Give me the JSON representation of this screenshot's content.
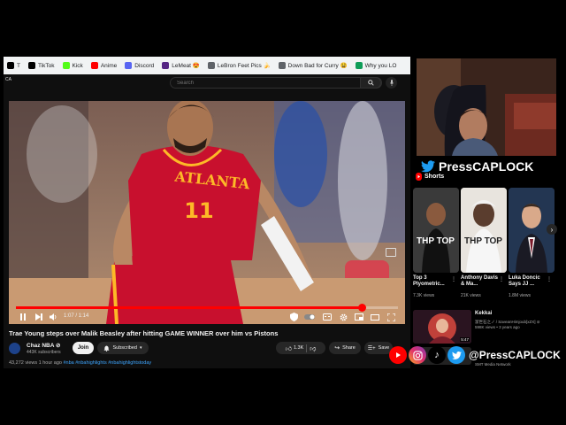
{
  "bookmarks": [
    {
      "label": "T",
      "icon": "x-icon",
      "color": "#000000"
    },
    {
      "label": "TikTok",
      "icon": "tiktok-icon",
      "color": "#000000"
    },
    {
      "label": "Kick",
      "icon": "kick-icon",
      "color": "#53fc18"
    },
    {
      "label": "Anime",
      "icon": "youtube-icon",
      "color": "#ff0000"
    },
    {
      "label": "Discord",
      "icon": "discord-icon",
      "color": "#5865f2"
    },
    {
      "label": "LeMeat 😍",
      "icon": "lebron-icon",
      "color": "#552583"
    },
    {
      "label": "LeBron Feet Pics 🍌",
      "icon": "folder-icon",
      "color": "#5f6368"
    },
    {
      "label": "Down Bad for Curry 😫",
      "icon": "folder-icon",
      "color": "#5f6368"
    },
    {
      "label": "Why you LO",
      "icon": "sheets-icon",
      "color": "#0f9d58"
    }
  ],
  "search": {
    "placeholder": "Search"
  },
  "player": {
    "time": "1:07 / 1:14",
    "progress": 0.905,
    "jersey_text": "ATLANTA",
    "jersey_number": "11"
  },
  "video": {
    "title": "Trae Young steps over Malik Beasley after hitting GAME WINNER over him vs Pistons",
    "channel": "Chaz NBA ⊘",
    "subscribers": "443K subscribers",
    "join_label": "Join",
    "subscribed_label": "Subscribed",
    "likes": "1.3K",
    "share_label": "Share",
    "save_label": "Save",
    "views": "43,272 views  1 hour ago",
    "tags": "#nba #nbahighlights #nbahighlightstoday"
  },
  "brand": "PressCAPLOCK",
  "shorts": {
    "heading": "Shorts",
    "items": [
      {
        "title": "Top 3 Plyometric...",
        "views": "7.3K views",
        "thumb_text": "THP TOP",
        "color": "#2b2b2b"
      },
      {
        "title": "Anthony Davis & Ma...",
        "views": "21K views",
        "thumb_text": "THP TOP",
        "color": "#d8d3cc"
      },
      {
        "title": "Luka Doncic Says JJ ...",
        "views": "1.8M views",
        "thumb_text": "",
        "color": "#1c2a3f"
      }
    ]
  },
  "recommendations": [
    {
      "title": "Kekkai",
      "duration": "5:47",
      "meta1": "潔世石之ノ / SaveanHimjoub[xZX] ⊘",
      "meta2": "598K views • 3 years ago"
    },
    {
      "meta": "SMT Media Network"
    }
  ],
  "socials": {
    "handle": "@PressCAPLOCK",
    "icons": [
      "youtube-icon",
      "instagram-icon",
      "tiktok-icon",
      "twitter-icon"
    ]
  },
  "colors": {
    "youtube_red": "#ff0000",
    "twitter_blue": "#1d9bf0",
    "hawks_red": "#c8102e"
  }
}
